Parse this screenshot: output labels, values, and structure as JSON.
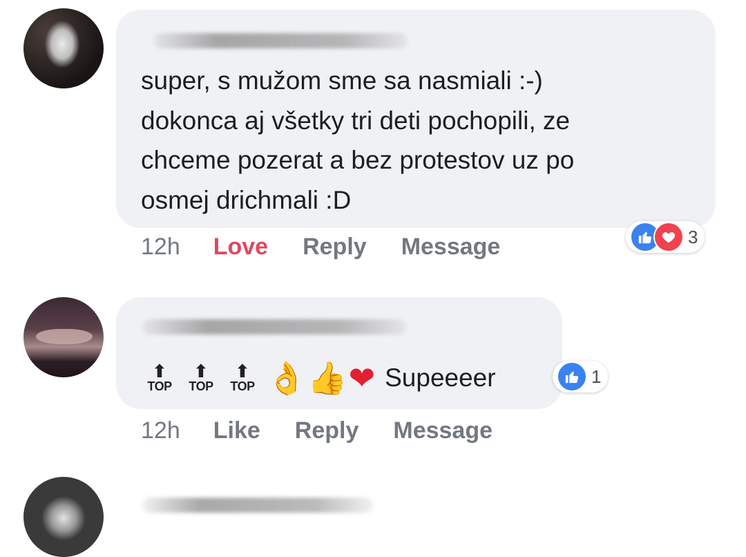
{
  "comments": [
    {
      "text": "super, s mužom sme sa nasmiali :-)\ndokonca aj všetky tri deti pochopili, ze\nchceme pozerat a bez protestov uz po\nosmej drichmali :D",
      "actions": {
        "time": "12h",
        "love": "Love",
        "reply": "Reply",
        "message": "Message"
      },
      "reactions": {
        "icons": [
          "like-icon",
          "love-icon"
        ],
        "count": "3"
      }
    },
    {
      "top_labels": [
        "TOP",
        "TOP",
        "TOP"
      ],
      "emojis": [
        "ok-hand-icon",
        "thumbs-up-icon",
        "heart-icon"
      ],
      "text": "Supeeeer",
      "actions": {
        "time": "12h",
        "like": "Like",
        "reply": "Reply",
        "message": "Message"
      },
      "reactions": {
        "icons": [
          "like-icon"
        ],
        "count": "1"
      }
    }
  ],
  "colors": {
    "bubble": "#f0f1f4",
    "action_text": "#737880",
    "love_action": "#e0485e",
    "like_reaction": "#3b82f0",
    "love_reaction": "#f0424f"
  }
}
